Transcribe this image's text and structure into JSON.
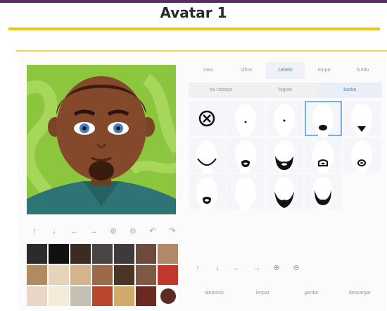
{
  "title": "Avatar 1",
  "tabs": [
    {
      "label": "cara"
    },
    {
      "label": "olhos"
    },
    {
      "label": "cabelo"
    },
    {
      "label": "roupa"
    },
    {
      "label": "fundo"
    }
  ],
  "active_tab": "cabelo",
  "subtabs": [
    {
      "label": "na cabeça"
    },
    {
      "label": "bigote"
    },
    {
      "label": "barba"
    }
  ],
  "active_subtab": "barba",
  "toolbar_icons": [
    "arrow-up-icon",
    "arrow-down-icon",
    "arrow-left-icon",
    "arrow-right-icon",
    "zoom-in-icon",
    "zoom-out-icon",
    "undo-icon",
    "redo-icon"
  ],
  "item_toolbar_icons": [
    "arrow-up-icon",
    "arrow-down-icon",
    "arrow-left-icon",
    "arrow-right-icon",
    "zoom-in-icon",
    "zoom-out-icon"
  ],
  "beard_options": [
    "none",
    "dot-small",
    "dot-tiny",
    "goatee",
    "soul-patch",
    "chin-strap",
    "short-goatee",
    "full-beard",
    "mustache-goatee",
    "ring-small",
    "ring-outline",
    "blank",
    "anchor",
    "curved-beard"
  ],
  "selected_beard": "goatee",
  "palette": [
    "#2b2b2b",
    "#111111",
    "#3b2b22",
    "#4a4444",
    "#3e3a3a",
    "#6d4a3c",
    "#b08a68",
    "#b28a62",
    "#e6d3b8",
    "#d4b48c",
    "#9b6a4a",
    "#4b3526",
    "#7e5a44",
    "#c0392b",
    "#e8d7c8",
    "#f6ead8",
    "#c4c0b4",
    "#b8472c",
    "#d2aa6a",
    "#6b2a20"
  ],
  "selected_color": "#5b2b24",
  "actions": {
    "random": "aleatório",
    "clear": "limpar",
    "save": "gardar",
    "download": "descargar"
  }
}
